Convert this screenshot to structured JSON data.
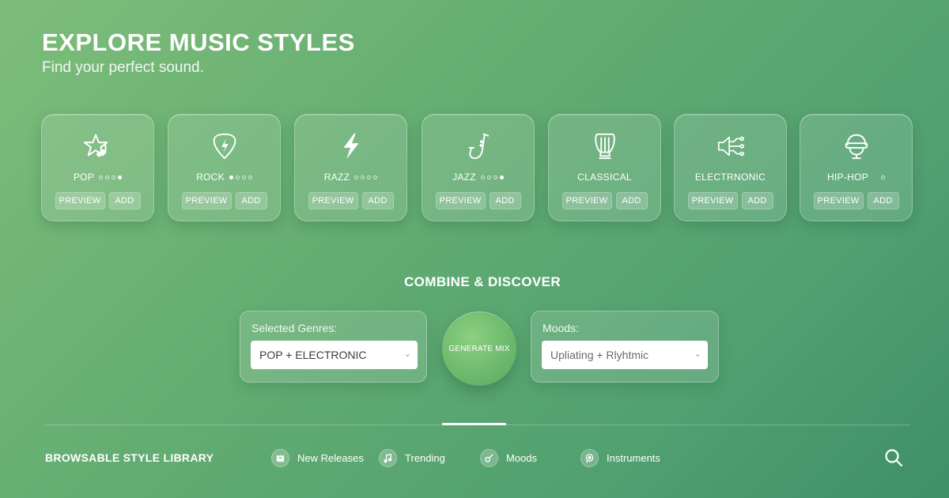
{
  "header": {
    "title": "EXPLORE MUSIC STYLES",
    "subtitle": "Find your perfect sound."
  },
  "genres": [
    {
      "label": "POP",
      "icon": "star-music-icon",
      "dots_total": 4,
      "dots_active": [
        3
      ],
      "preview": "PREVIEW",
      "add": "ADD"
    },
    {
      "label": "ROCK",
      "icon": "guitar-pick-icon",
      "dots_total": 4,
      "dots_active": [
        1
      ],
      "preview": "PREVIEW",
      "add": "ADD"
    },
    {
      "label": "RAZZ",
      "icon": "lightning-icon",
      "dots_total": 4,
      "dots_active": [],
      "preview": "PREVIEW",
      "add": "ADD"
    },
    {
      "label": "JAZZ",
      "icon": "saxophone-icon",
      "dots_total": 4,
      "dots_active": [
        3
      ],
      "preview": "PREVIEW",
      "add": "ADD"
    },
    {
      "label": "CLASSICAL",
      "icon": "lyre-icon",
      "dots_total": 0,
      "dots_active": [],
      "preview": "PREVIEW",
      "add": "ADD"
    },
    {
      "label": "ELECTRNONIC",
      "icon": "speaker-circuit-icon",
      "dots_total": 0,
      "dots_active": [],
      "preview": "PREVIEW",
      "add": "ADD"
    },
    {
      "label": "HIP-HOP",
      "icon": "headphones-mic-icon",
      "dots_total": 1,
      "dots_active": [],
      "preview": "PREVIEW",
      "add": "ADD"
    }
  ],
  "combine": {
    "title": "COMBINE & DISCOVER",
    "genres_label": "Selected Genres:",
    "genres_value": "POP + ELECTRONIC",
    "generate_label": "GENERATE MIX",
    "moods_label": "Moods:",
    "moods_value": "Upliating + Rlyhtmic"
  },
  "library": {
    "title": "BROWSABLE STYLE LIBRARY",
    "items": [
      {
        "label": "New Releases",
        "icon": "new-releases-icon"
      },
      {
        "label": "Trending",
        "icon": "music-note-icon"
      },
      {
        "label": "Moods",
        "icon": "guitar-icon"
      },
      {
        "label": "Instruments",
        "icon": "instrument-icon"
      }
    ],
    "search_icon": "search-icon"
  }
}
